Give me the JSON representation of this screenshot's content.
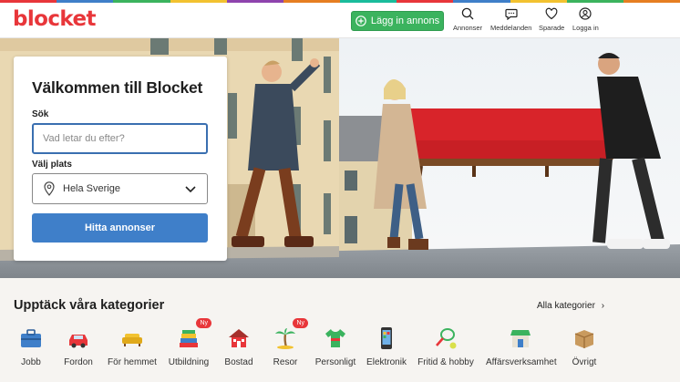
{
  "brand": {
    "logo_text": "blocket",
    "accent": "#e8363a"
  },
  "header": {
    "post_button": "Lägg in annons",
    "nav": [
      {
        "label": "Annonser",
        "icon": "search-icon"
      },
      {
        "label": "Meddelanden",
        "icon": "chat-icon"
      },
      {
        "label": "Sparade",
        "icon": "heart-icon"
      },
      {
        "label": "Logga in",
        "icon": "user-icon"
      }
    ]
  },
  "search_card": {
    "title": "Välkommen till Blocket",
    "search_label": "Sök",
    "search_placeholder": "Vad letar du efter?",
    "place_label": "Välj plats",
    "place_value": "Hela Sverige",
    "submit_label": "Hitta annonser"
  },
  "categories": {
    "title": "Upptäck våra kategorier",
    "all_link": "Alla kategorier",
    "items": [
      {
        "label": "Jobb",
        "icon": "briefcase-icon"
      },
      {
        "label": "Fordon",
        "icon": "car-icon"
      },
      {
        "label": "För hemmet",
        "icon": "sofa-icon"
      },
      {
        "label": "Utbildning",
        "icon": "books-icon",
        "badge": "Ny"
      },
      {
        "label": "Bostad",
        "icon": "house-icon"
      },
      {
        "label": "Resor",
        "icon": "palm-tree-icon",
        "badge": "Ny"
      },
      {
        "label": "Personligt",
        "icon": "shirt-icon"
      },
      {
        "label": "Elektronik",
        "icon": "phone-icon"
      },
      {
        "label": "Fritid & hobby",
        "icon": "racket-icon"
      },
      {
        "label": "Affärsverksamhet",
        "icon": "shop-icon"
      },
      {
        "label": "Övrigt",
        "icon": "box-icon"
      }
    ]
  }
}
